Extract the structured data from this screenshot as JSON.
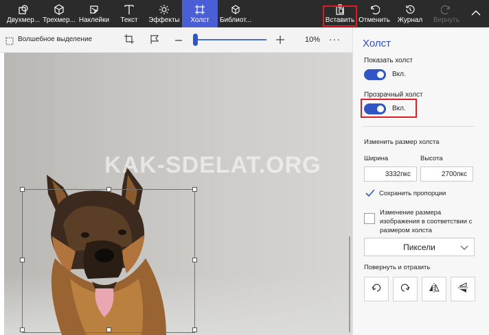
{
  "toolbar": {
    "tools": [
      {
        "label": "Двухмер...",
        "icon": "2d-shapes-icon"
      },
      {
        "label": "Трехмер...",
        "icon": "3d-shapes-icon"
      },
      {
        "label": "Наклейки",
        "icon": "stickers-icon"
      },
      {
        "label": "Текст",
        "icon": "text-icon"
      },
      {
        "label": "Эффекты",
        "icon": "effects-icon"
      },
      {
        "label": "Холст",
        "icon": "canvas-icon",
        "active": true
      },
      {
        "label": "Библиот...",
        "icon": "3d-library-icon"
      }
    ],
    "paste_label": "Вставить",
    "undo_label": "Отменить",
    "history_label": "Журнал",
    "redo_label": "Вернуть",
    "accent_color": "#4a5fd6",
    "highlight_color": "#e01b24"
  },
  "subtoolbar": {
    "magic_select_label": "Волшебное выделение",
    "zoom_value": "10%",
    "zoom_slider_fraction": 0.02,
    "more_label": "···"
  },
  "canvas": {
    "watermark": "KAK-SDELAT.ORG"
  },
  "panel": {
    "title": "Холст",
    "show_canvas_label": "Показать холст",
    "show_canvas_state": "Вкл.",
    "transparent_canvas_label": "Прозрачный холст",
    "transparent_canvas_state": "Вкл.",
    "resize_label": "Изменить размер холста",
    "width_label": "Ширина",
    "height_label": "Высота",
    "width_value": "3332пкс",
    "height_value": "2700пкс",
    "keep_ratio_label": "Сохранить пропорции",
    "keep_ratio_checked": true,
    "resize_image_label_1": "Изменение размера",
    "resize_image_label_2": "изображения в соответствии с",
    "resize_image_label_3": "размером холста",
    "resize_image_checked": false,
    "units_value": "Пиксели",
    "rotate_label": "Повернуть и отразить",
    "accent_color": "#2f56c4"
  }
}
